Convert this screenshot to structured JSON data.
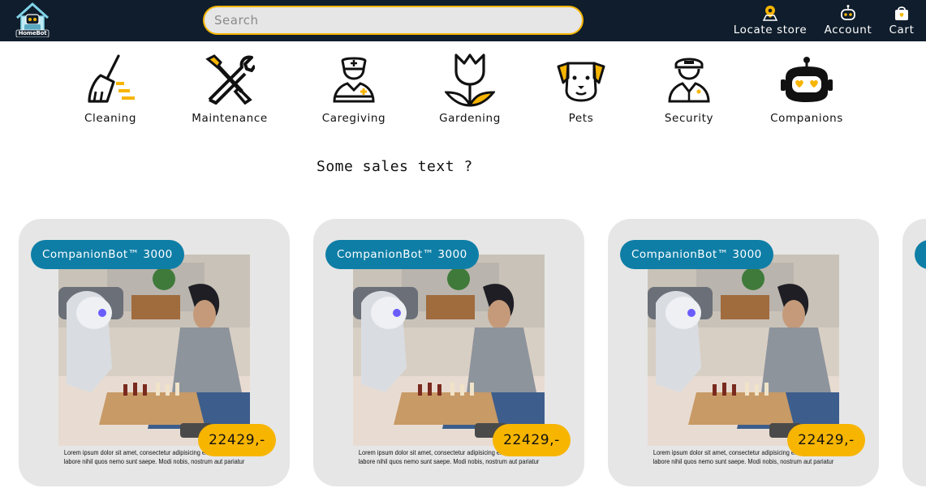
{
  "brand": {
    "logo_text": "HomeBot"
  },
  "search": {
    "placeholder": "Search",
    "value": ""
  },
  "nav": {
    "locate": "Locate store",
    "account": "Account",
    "cart": "Cart"
  },
  "categories": [
    {
      "label": "Cleaning",
      "icon": "broom-icon"
    },
    {
      "label": "Maintenance",
      "icon": "wrench-screwdriver-icon"
    },
    {
      "label": "Caregiving",
      "icon": "nurse-icon"
    },
    {
      "label": "Gardening",
      "icon": "tulip-icon"
    },
    {
      "label": "Pets",
      "icon": "dog-icon"
    },
    {
      "label": "Security",
      "icon": "guard-icon"
    },
    {
      "label": "Companions",
      "icon": "robot-heart-icon"
    }
  ],
  "sales_text": "Some sales text ?",
  "products": [
    {
      "name": "CompanionBot™ 3000",
      "price": "22429,-",
      "description": "Lorem ipsum dolor sit amet, consectetur adipisicing elit. Ipsam quod labore nihil quos nemo sunt saepe. Modi nobis, nostrum aut pariatur"
    },
    {
      "name": "CompanionBot™ 3000",
      "price": "22429,-",
      "description": "Lorem ipsum dolor sit amet, consectetur adipisicing elit. Ipsam quod labore nihil quos nemo sunt saepe. Modi nobis, nostrum aut pariatur"
    },
    {
      "name": "CompanionBot™ 3000",
      "price": "22429,-",
      "description": "Lorem ipsum dolor sit amet, consectetur adipisicing elit. Ipsam quod labore nihil quos nemo sunt saepe. Modi nobis, nostrum aut pariatur"
    }
  ],
  "colors": {
    "header_bg": "#0f1d2c",
    "accent_yellow": "#f7b500",
    "badge_blue": "#0e7ea6",
    "card_bg": "#e6e6e6"
  }
}
